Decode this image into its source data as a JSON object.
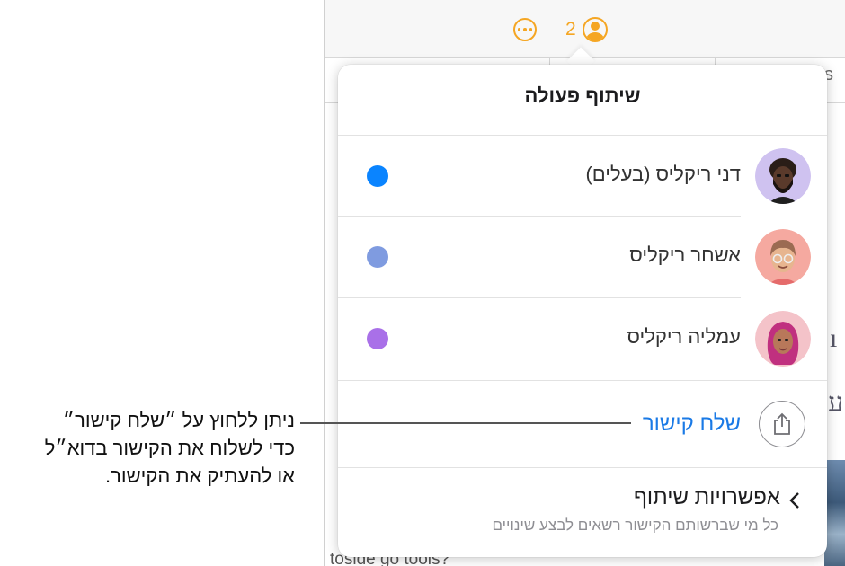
{
  "toolbar": {
    "collaborator_count": "2",
    "more_icon": "ellipsis-circle-icon",
    "collab_icon": "person-circle-icon"
  },
  "background": {
    "tab_fragment": "s",
    "glyph_1": "ı",
    "glyph_2": "ע",
    "bottom_text": "toside go tools?"
  },
  "popover": {
    "title": "שיתוף פעולה",
    "participants": [
      {
        "name": "דני ריקליס (בעלים)",
        "color": "#0a84ff",
        "avatar": "memoji-dark-beard"
      },
      {
        "name": "אשחר ריקליס",
        "color": "#7f9be0",
        "avatar": "memoji-glasses"
      },
      {
        "name": "עמליה ריקליס",
        "color": "#a970e8",
        "avatar": "memoji-pink-hair"
      }
    ],
    "send_link_label": "שלח קישור",
    "share_icon": "share-icon",
    "options_title": "אפשרויות שיתוף",
    "options_subtitle": "כל מי שברשותם הקישור רשאים לבצע שינויים",
    "chevron_icon": "chevron-left-icon"
  },
  "callout": {
    "line1": "ניתן ללחוץ על ״שלח קישור״",
    "line2": "כדי לשלוח את הקישור בדוא״ל",
    "line3": "או להעתיק את הקישור."
  }
}
